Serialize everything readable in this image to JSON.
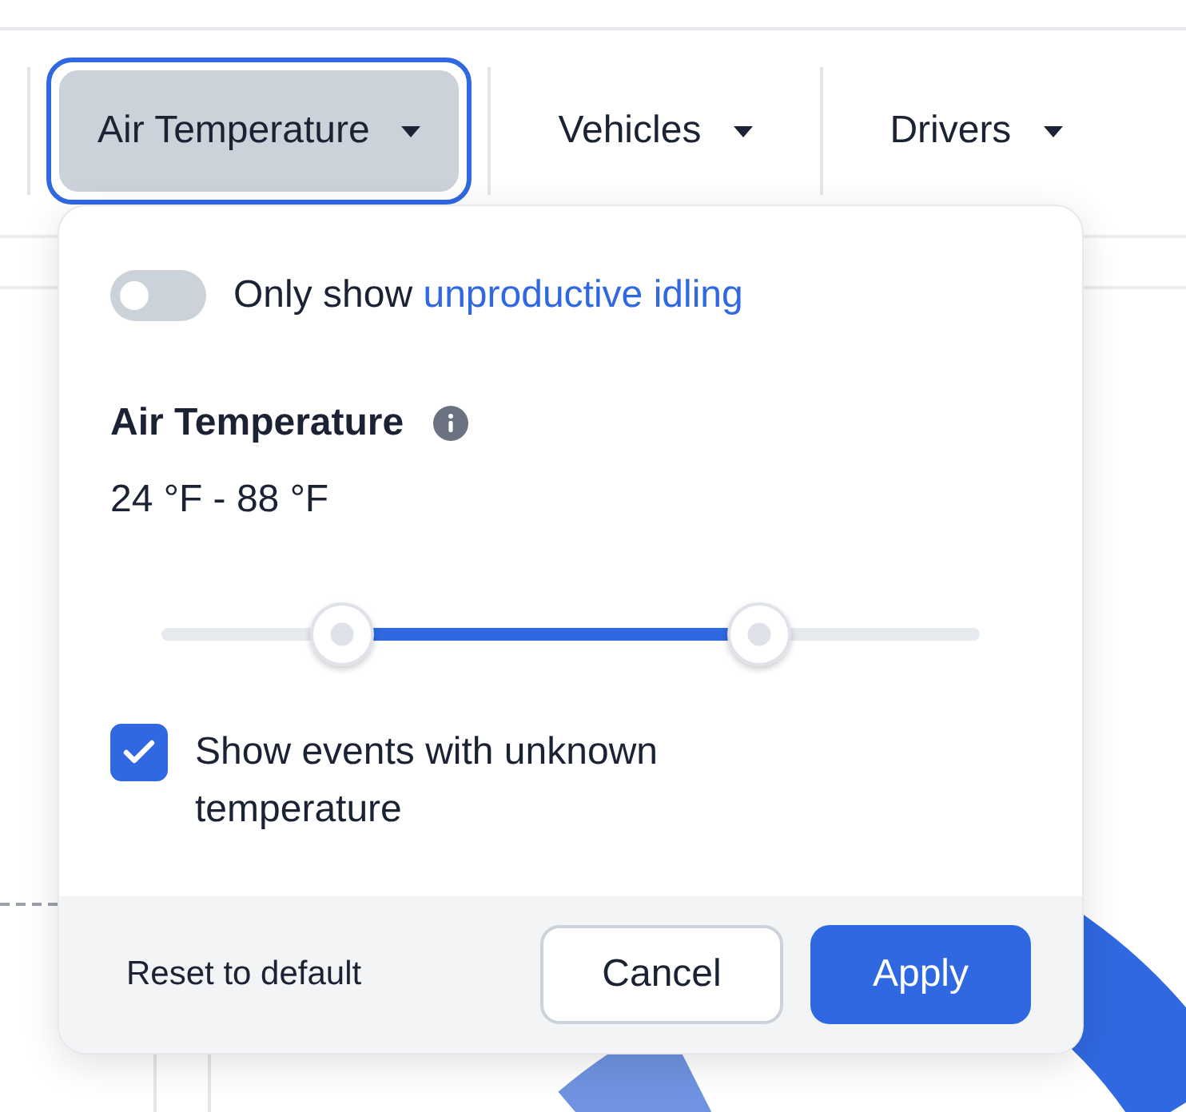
{
  "filters": [
    {
      "label": "Air Temperature",
      "selected": true
    },
    {
      "label": "Vehicles",
      "selected": false
    },
    {
      "label": "Drivers",
      "selected": false
    }
  ],
  "popover": {
    "toggle": {
      "label": "Only show",
      "link": "unproductive idling",
      "on": false
    },
    "title": "Air Temperature",
    "range": "24 °F - 88 °F",
    "slider": {
      "thumbs": [
        {
          "level": 0.22
        },
        {
          "level": 0.73
        }
      ]
    },
    "checkbox": {
      "label": "Show events with unknown temperature",
      "checked": true
    },
    "footer": {
      "reset": "Reset to default",
      "cancel": "Cancel",
      "apply": "Apply"
    }
  }
}
